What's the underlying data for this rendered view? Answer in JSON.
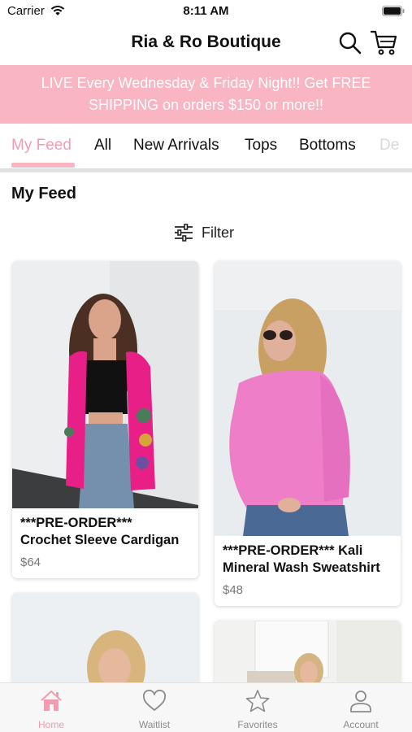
{
  "status_bar": {
    "carrier": "Carrier",
    "time": "8:11 AM"
  },
  "header": {
    "title": "Ria & Ro Boutique"
  },
  "banner": {
    "text": "LIVE Every Wednesday & Friday Night!!  Get FREE SHIPPING on orders $150 or more!!",
    "background": "#f9b5c2"
  },
  "tabs": [
    {
      "label": "My Feed",
      "active": true
    },
    {
      "label": "All"
    },
    {
      "label": "New Arrivals"
    },
    {
      "label": "Tops"
    },
    {
      "label": "Bottoms"
    },
    {
      "label": "De"
    }
  ],
  "section": {
    "title": "My Feed"
  },
  "filter": {
    "label": "Filter"
  },
  "products": [
    {
      "name": "***PRE-ORDER***\nCrochet Sleeve Cardigan",
      "price": "$64"
    },
    {
      "name": "***PRE-ORDER*** Kali Mineral Wash Sweatshirt",
      "price": "$48"
    }
  ],
  "bottom_nav": [
    {
      "label": "Home",
      "icon": "home-icon",
      "active": true
    },
    {
      "label": "Waitlist",
      "icon": "heart-icon"
    },
    {
      "label": "Favorites",
      "icon": "star-icon"
    },
    {
      "label": "Account",
      "icon": "account-icon"
    }
  ],
  "colors": {
    "accent": "#f49bb0",
    "banner": "#f9b5c2",
    "inactive": "#8b8b8b"
  }
}
